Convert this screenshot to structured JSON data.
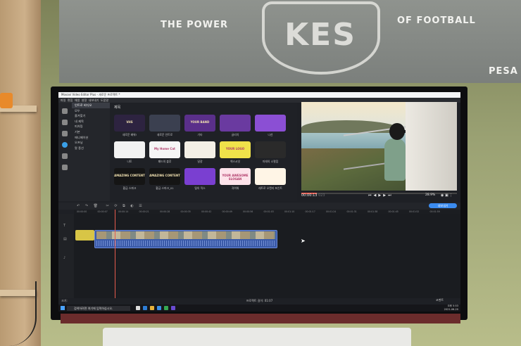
{
  "flag": {
    "left": "THE POWER",
    "right": "OF FOOTBALL",
    "far_right": "PESA",
    "emblem": "KES"
  },
  "app": {
    "title": "Movavi Video Editor Plus - 새로운 프로젝트 *",
    "menu": [
      "파일",
      "편집",
      "재생",
      "설정",
      "내보내기",
      "도움말"
    ],
    "categories": [
      "인트로 비디오",
      "모두",
      "즐겨찾기",
      "내 제목",
      "피처링",
      "기본",
      "애니메이션",
      "오프닝",
      "말 풍선"
    ],
    "library_title": "제목",
    "tiles": [
      {
        "label": "새로운 배워!",
        "text": "VHS",
        "color": "#2d2340"
      },
      {
        "label": "새로운 인트로",
        "text": "",
        "color": "#3b4050"
      },
      {
        "label": "기타",
        "text": "YOUR BAND",
        "color": "#5a2f8a"
      },
      {
        "label": "글리치",
        "text": "",
        "color": "#6a3aa0"
      },
      {
        "label": "나선",
        "text": "",
        "color": "#8b4fd4"
      },
      {
        "label": "나토",
        "text": "",
        "color": "#f2f2f2"
      },
      {
        "label": "패드의 블루",
        "text": "My Home Cat",
        "color": "#f5f5f5"
      },
      {
        "label": "달걀",
        "text": "",
        "color": "#f4efe6"
      },
      {
        "label": "엑스시잇",
        "text": "YOUR LOGO",
        "color": "#f0e24a"
      },
      {
        "label": "미래의 소멸점",
        "text": "",
        "color": "#2a2a2a"
      },
      {
        "label": "황금 스파크",
        "text": "AMAZING CONTENT",
        "color": "#151515"
      },
      {
        "label": "황금 스파크_01",
        "text": "AMAZING CONTENT",
        "color": "#151515"
      },
      {
        "label": "털의 믹스",
        "text": "",
        "color": "#7a3fd1"
      },
      {
        "label": "귀여워",
        "text": "YOUR AWESOME SLOGAN",
        "color": "#fde3ea"
      },
      {
        "label": "레트로 오렌지 포인트",
        "text": "",
        "color": "#fff5e6"
      }
    ],
    "timecode": "00:00:13",
    "timecode_frac": "023",
    "zoom": "28.9%",
    "export_label": "내보내기",
    "ruler": [
      "00:00:00",
      "00:00:07",
      "00:00:14",
      "00:00:21",
      "00:00:28",
      "00:00:35",
      "00:00:42",
      "00:00:49",
      "00:00:56",
      "00:01:03",
      "00:01:10",
      "00:01:17",
      "00:01:24",
      "00:01:31",
      "00:01:38",
      "00:01:45",
      "00:01:52",
      "00:01:59"
    ],
    "status": "프로젝트 길이: 01:07",
    "comment": "코멘트",
    "scale_label": "크기:"
  },
  "taskbar": {
    "search": "검색하려면 여기에 입력하십시오.",
    "time": "오후 5:53",
    "date": "2021-06-20"
  }
}
